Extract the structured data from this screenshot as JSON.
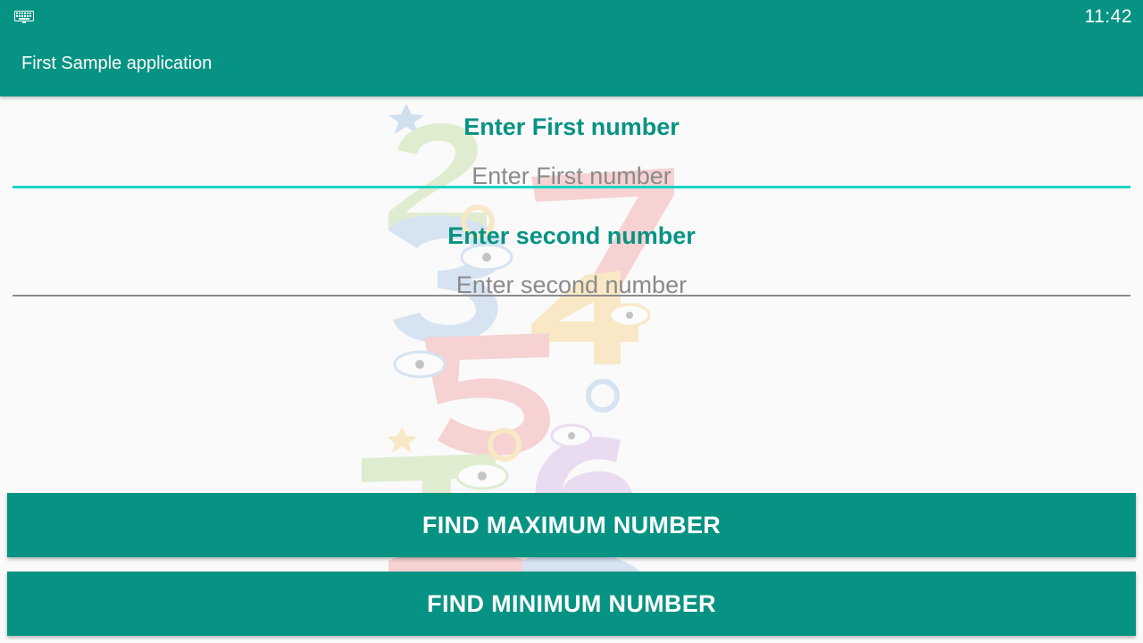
{
  "status_bar": {
    "time": "11:42",
    "left_icon": "keyboard-icon"
  },
  "app_bar": {
    "title": "First Sample application"
  },
  "form": {
    "first": {
      "label": "Enter First number",
      "value": "",
      "placeholder": "Enter First number",
      "focused": true
    },
    "second": {
      "label": "Enter second number",
      "value": "",
      "placeholder": "Enter second number",
      "focused": false
    }
  },
  "buttons": {
    "max_label": "FIND MAXIMUM NUMBER",
    "min_label": "FIND MINIMUM NUMBER"
  },
  "colors": {
    "primary": "#079383",
    "accent": "#1bd3c4",
    "hint": "#8a8a8a",
    "background": "#fafafa"
  },
  "background_art": "colorful-cartoon-numbers-illustration"
}
